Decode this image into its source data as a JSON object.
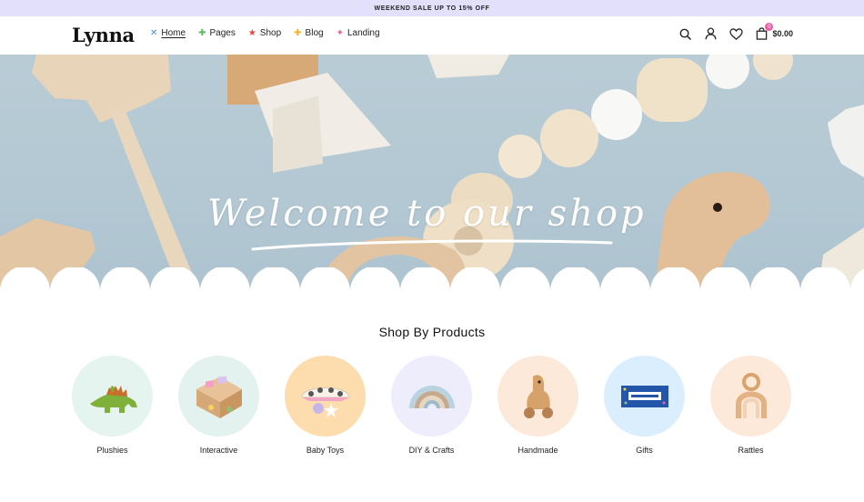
{
  "announcement": "WEEKEND SALE UP TO 15% OFF",
  "brand": {
    "logo": "Lynna"
  },
  "nav": [
    {
      "label": "Home",
      "icon": "cross-icon",
      "color": "#4a90d9",
      "active": true
    },
    {
      "label": "Pages",
      "icon": "plus-icon",
      "color": "#5cb85c"
    },
    {
      "label": "Shop",
      "icon": "star-icon",
      "color": "#e0483e"
    },
    {
      "label": "Blog",
      "icon": "plus-icon",
      "color": "#f0b429"
    },
    {
      "label": "Landing",
      "icon": "sparkle-icon",
      "color": "#ef5fa7"
    }
  ],
  "header": {
    "cart_count": "0",
    "cart_total": "$0.00"
  },
  "hero": {
    "title": "Welcome to our shop"
  },
  "section": {
    "title": "Shop By Products"
  },
  "categories": [
    {
      "label": "Plushies",
      "bg": "#e6f4ef",
      "icon": "dinosaur-icon"
    },
    {
      "label": "Interactive",
      "bg": "#e3f2ee",
      "icon": "puzzle-box-icon"
    },
    {
      "label": "Baby Toys",
      "bg": "#fddcae",
      "icon": "rattle-icon"
    },
    {
      "label": "DIY & Crafts",
      "bg": "#eeedfc",
      "icon": "rainbow-icon"
    },
    {
      "label": "Handmade",
      "bg": "#fde9da",
      "icon": "wooden-toy-icon"
    },
    {
      "label": "Gifts",
      "bg": "#dbeefd",
      "icon": "gift-voucher-icon"
    },
    {
      "label": "Rattles",
      "bg": "#fde9da",
      "icon": "teether-icon"
    }
  ],
  "colors": {
    "announce_bg": "#e3e0fb",
    "accent_pink": "#ef5fa7",
    "hero_bg": "#b5c9d4"
  }
}
